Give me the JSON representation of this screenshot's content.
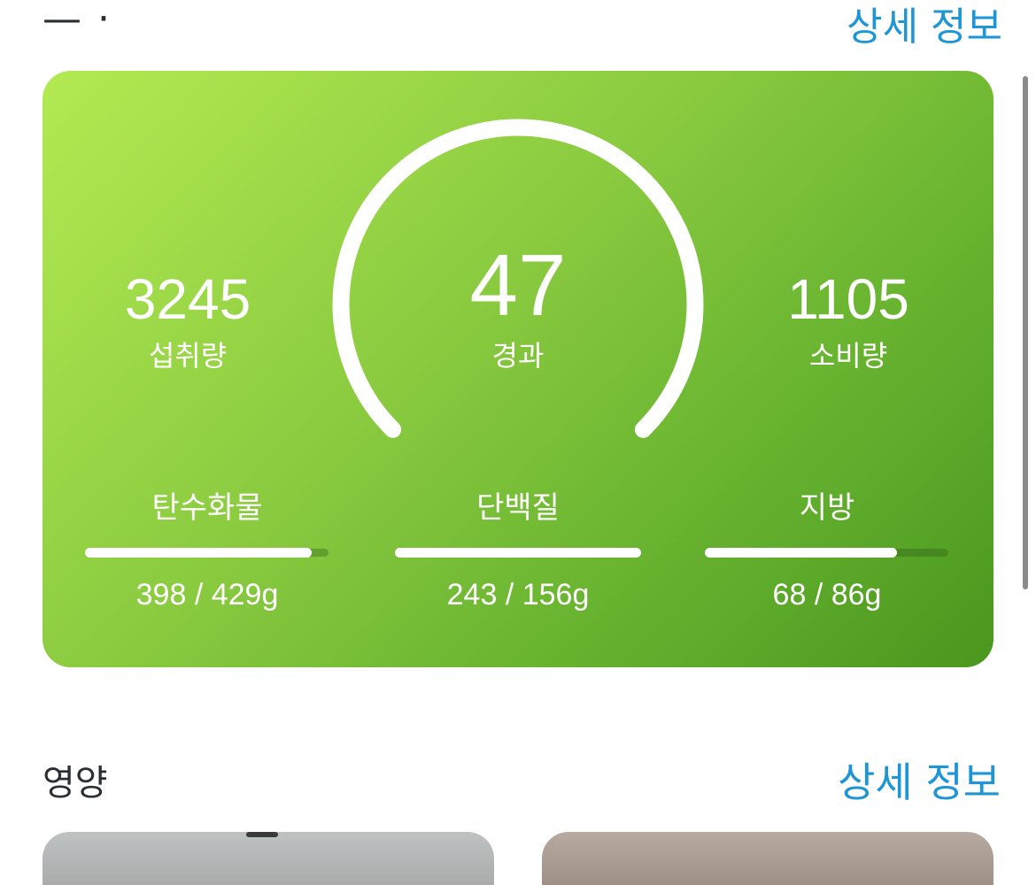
{
  "top_partial": {
    "title": "—  ·",
    "link": "상세 정보"
  },
  "summary": {
    "remaining_value": "47",
    "remaining_label": "경과",
    "intake_value": "3245",
    "intake_label": "섭취량",
    "burned_value": "1105",
    "burned_label": "소비량",
    "gauge_fraction": 1.0
  },
  "macros": [
    {
      "label": "탄수화물",
      "value_text": "398 / 429g",
      "progress": 0.93
    },
    {
      "label": "단백질",
      "value_text": "243 / 156g",
      "progress": 1.0
    },
    {
      "label": "지방",
      "value_text": "68 / 86g",
      "progress": 0.79
    }
  ],
  "nutrition_section": {
    "title": "영양",
    "link": "상세 정보"
  },
  "colors": {
    "card_gradient_start": "#b3ea52",
    "card_gradient_end": "#4b971f",
    "link": "#1e96d6",
    "text_dark": "#2b2f33"
  }
}
